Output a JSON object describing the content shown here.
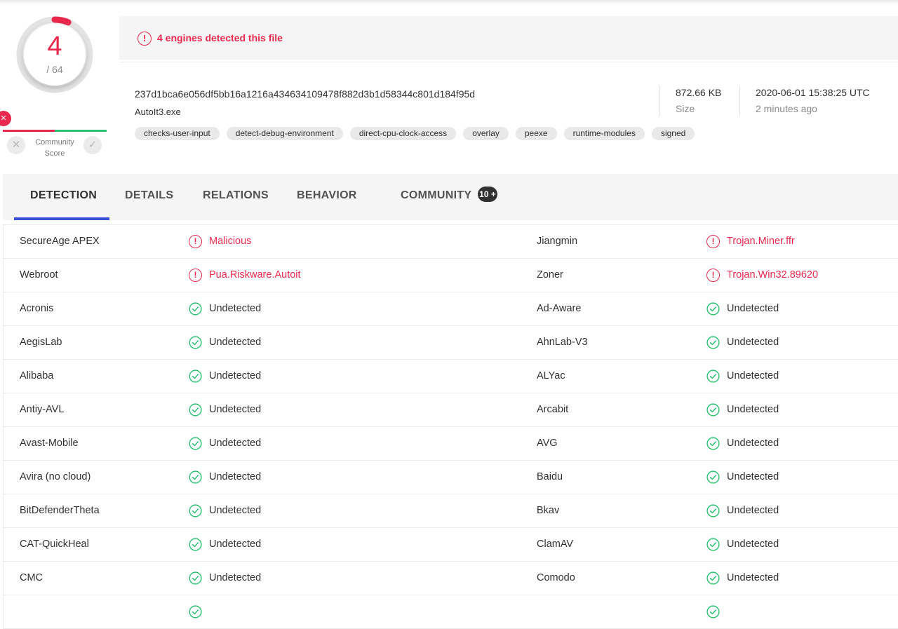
{
  "score": {
    "detected": "4",
    "total": "/ 64",
    "ring_fraction": 0.0625
  },
  "community": {
    "label_line1": "Community",
    "label_line2": "Score"
  },
  "banner": {
    "text": "4 engines detected this file"
  },
  "file": {
    "hash": "237d1bca6e056df5bb16a1216a434634109478f882d3b1d58344c801d184f95d",
    "name": "AutoIt3.exe",
    "tags": [
      "checks-user-input",
      "detect-debug-environment",
      "direct-cpu-clock-access",
      "overlay",
      "peexe",
      "runtime-modules",
      "signed"
    ],
    "size": "872.66 KB",
    "size_label": "Size",
    "date": "2020-06-01 15:38:25 UTC",
    "date_relative": "2 minutes ago"
  },
  "tabs": [
    {
      "label": "DETECTION"
    },
    {
      "label": "DETAILS"
    },
    {
      "label": "RELATIONS"
    },
    {
      "label": "BEHAVIOR"
    },
    {
      "label": "COMMUNITY",
      "badge": "10 +"
    }
  ],
  "rows": [
    [
      {
        "engine": "SecureAge APEX",
        "result": "Malicious",
        "status": "malicious"
      },
      {
        "engine": "Jiangmin",
        "result": "Trojan.Miner.ffr",
        "status": "malicious"
      }
    ],
    [
      {
        "engine": "Webroot",
        "result": "Pua.Riskware.Autoit",
        "status": "malicious"
      },
      {
        "engine": "Zoner",
        "result": "Trojan.Win32.89620",
        "status": "malicious"
      }
    ],
    [
      {
        "engine": "Acronis",
        "result": "Undetected",
        "status": "clean"
      },
      {
        "engine": "Ad-Aware",
        "result": "Undetected",
        "status": "clean"
      }
    ],
    [
      {
        "engine": "AegisLab",
        "result": "Undetected",
        "status": "clean"
      },
      {
        "engine": "AhnLab-V3",
        "result": "Undetected",
        "status": "clean"
      }
    ],
    [
      {
        "engine": "Alibaba",
        "result": "Undetected",
        "status": "clean"
      },
      {
        "engine": "ALYac",
        "result": "Undetected",
        "status": "clean"
      }
    ],
    [
      {
        "engine": "Antiy-AVL",
        "result": "Undetected",
        "status": "clean"
      },
      {
        "engine": "Arcabit",
        "result": "Undetected",
        "status": "clean"
      }
    ],
    [
      {
        "engine": "Avast-Mobile",
        "result": "Undetected",
        "status": "clean"
      },
      {
        "engine": "AVG",
        "result": "Undetected",
        "status": "clean"
      }
    ],
    [
      {
        "engine": "Avira (no cloud)",
        "result": "Undetected",
        "status": "clean"
      },
      {
        "engine": "Baidu",
        "result": "Undetected",
        "status": "clean"
      }
    ],
    [
      {
        "engine": "BitDefenderTheta",
        "result": "Undetected",
        "status": "clean"
      },
      {
        "engine": "Bkav",
        "result": "Undetected",
        "status": "clean"
      }
    ],
    [
      {
        "engine": "CAT-QuickHeal",
        "result": "Undetected",
        "status": "clean"
      },
      {
        "engine": "ClamAV",
        "result": "Undetected",
        "status": "clean"
      }
    ],
    [
      {
        "engine": "CMC",
        "result": "Undetected",
        "status": "clean"
      },
      {
        "engine": "Comodo",
        "result": "Undetected",
        "status": "clean"
      }
    ],
    [
      {
        "engine": "",
        "result": "",
        "status": "clean"
      },
      {
        "engine": "",
        "result": "",
        "status": "clean"
      }
    ]
  ],
  "colors": {
    "malicious": "#e8294d",
    "clean": "#2fbf71",
    "accent": "#3a4fd8"
  }
}
